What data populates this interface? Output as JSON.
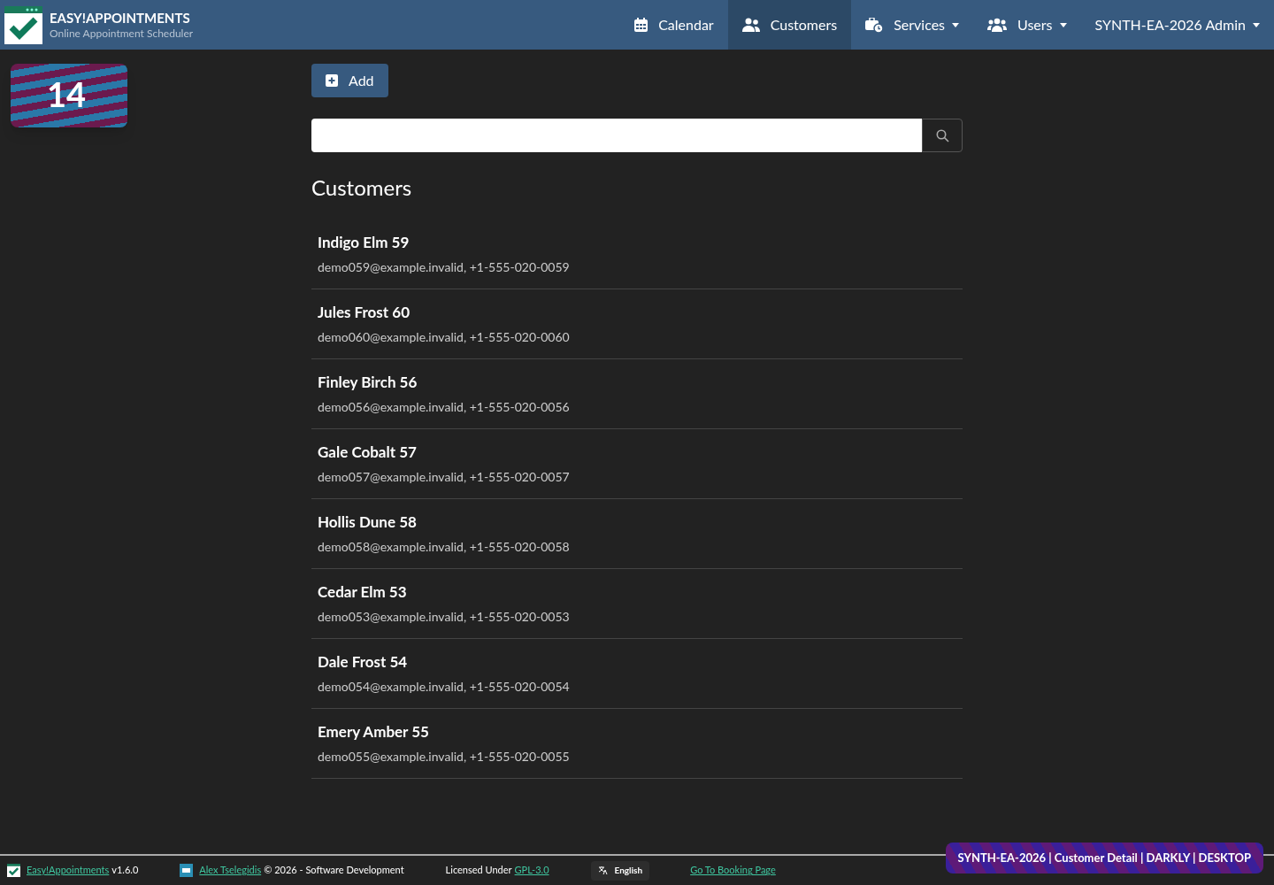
{
  "brand": {
    "title": "EASY!APPOINTMENTS",
    "subtitle": "Online Appointment Scheduler"
  },
  "nav": [
    {
      "label": "Calendar",
      "kind": "calendar",
      "dropdown": false,
      "selected": false
    },
    {
      "label": "Customers",
      "kind": "users",
      "dropdown": false,
      "selected": true
    },
    {
      "label": "Services",
      "kind": "briefcase",
      "dropdown": true,
      "selected": false
    },
    {
      "label": "Users",
      "kind": "group",
      "dropdown": true,
      "selected": false
    },
    {
      "label": "SYNTH-EA-2026 Admin",
      "kind": "menu",
      "dropdown": true,
      "selected": false
    }
  ],
  "counter_badge": "14",
  "add_button": "Add",
  "heading": "Customers",
  "customers": [
    {
      "name": "Indigo Elm 59",
      "details": "demo059@example.invalid, +1-555-020-0059"
    },
    {
      "name": "Jules Frost 60",
      "details": "demo060@example.invalid, +1-555-020-0060"
    },
    {
      "name": "Finley Birch 56",
      "details": "demo056@example.invalid, +1-555-020-0056"
    },
    {
      "name": "Gale Cobalt 57",
      "details": "demo057@example.invalid, +1-555-020-0057"
    },
    {
      "name": "Hollis Dune 58",
      "details": "demo058@example.invalid, +1-555-020-0058"
    },
    {
      "name": "Cedar Elm 53",
      "details": "demo053@example.invalid, +1-555-020-0053"
    },
    {
      "name": "Dale Frost 54",
      "details": "demo054@example.invalid, +1-555-020-0054"
    },
    {
      "name": "Emery Amber 55",
      "details": "demo055@example.invalid, +1-555-020-0055"
    }
  ],
  "footer": {
    "app_link": "Easy!Appointments",
    "version": "v1.6.0",
    "author_link": "Alex Tselegidis",
    "copyright": "© 2026 - Software Development",
    "license_prefix": "Licensed Under",
    "license_link": "GPL-3.0",
    "language": "English",
    "booking_link": "Go To Booking Page"
  },
  "banner": "SYNTH-EA-2026 | Customer Detail | DARKLY | DESKTOP"
}
